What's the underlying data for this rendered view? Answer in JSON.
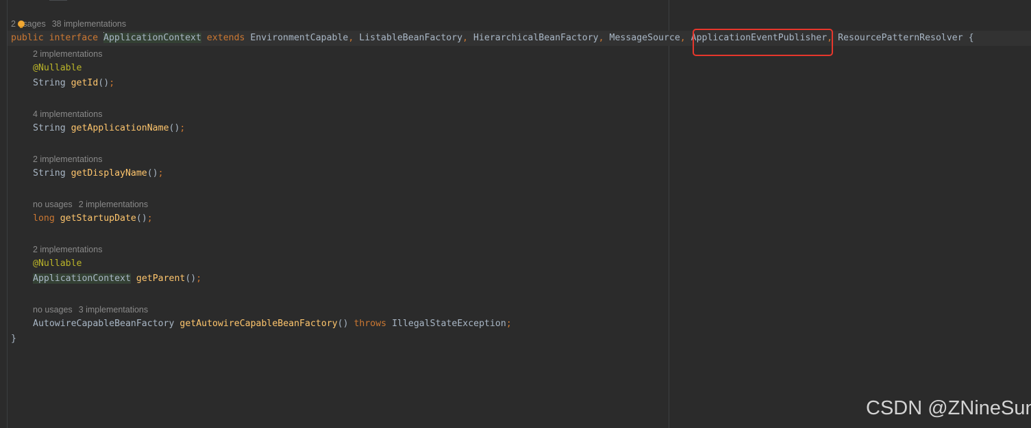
{
  "editor": {
    "interface_hint": {
      "usages": "2 usages",
      "implementations": "38 implementations"
    },
    "declaration": {
      "public": "public",
      "interface": "interface",
      "name": "ApplicationContext",
      "extends": "extends",
      "parents": [
        "EnvironmentCapable",
        "ListableBeanFactory",
        "HierarchicalBeanFactory",
        "MessageSource",
        "ApplicationEventPublisher",
        "ResourcePatternResolver"
      ],
      "comma": ",",
      "open_brace": "{"
    },
    "methods": [
      {
        "hint_impl": "2 implementations",
        "annotation": "@Nullable",
        "return_type": "String",
        "name": "getId",
        "parens": "()",
        "semi": ";"
      },
      {
        "hint_impl": "4 implementations",
        "return_type": "String",
        "name": "getApplicationName",
        "parens": "()",
        "semi": ";"
      },
      {
        "hint_impl": "2 implementations",
        "return_type": "String",
        "name": "getDisplayName",
        "parens": "()",
        "semi": ";"
      },
      {
        "hint_usages": "no usages",
        "hint_impl": "2 implementations",
        "return_type": "long",
        "name": "getStartupDate",
        "parens": "()",
        "semi": ";"
      },
      {
        "hint_impl": "2 implementations",
        "annotation": "@Nullable",
        "return_type": "ApplicationContext",
        "name": "getParent",
        "parens": "()",
        "semi": ";"
      },
      {
        "hint_usages": "no usages",
        "hint_impl": "3 implementations",
        "return_type": "AutowireCapableBeanFactory",
        "name": "getAutowireCapableBeanFactory",
        "parens": "()",
        "throws": "throws",
        "exception": "IllegalStateException",
        "semi": ";"
      }
    ],
    "close_brace": "}"
  },
  "highlight": {
    "target": "ApplicationEventPublisher",
    "box_color": "#e8372c"
  },
  "watermark": "CSDN @ZNineSun",
  "colors": {
    "background": "#2b2b2b",
    "keyword": "#cc7832",
    "method": "#ffc66d",
    "annotation": "#bbb529",
    "identifier": "#a9b7c6",
    "hint": "#8a8a8a"
  }
}
